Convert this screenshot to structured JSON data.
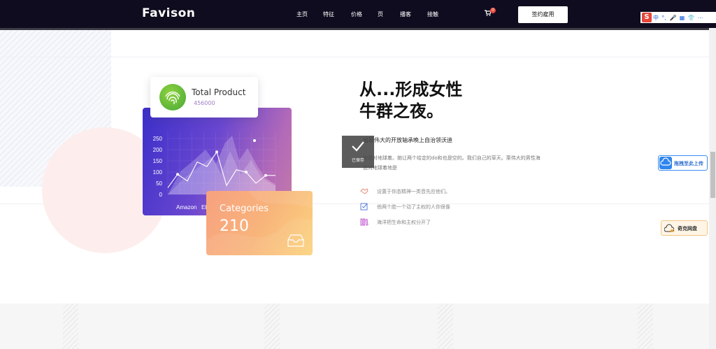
{
  "nav": {
    "brand": "Favison",
    "items": [
      "主页",
      "特征",
      "价格",
      "页",
      "播客",
      "接触"
    ],
    "cart_badge": "0",
    "signup": "签约雇用"
  },
  "ime": {
    "label": "中",
    "symbols": [
      "°,",
      "🎤",
      "▦",
      "👕",
      "⋯"
    ]
  },
  "total_product": {
    "title": "Total Product",
    "value": "456000"
  },
  "chart_data": {
    "type": "area",
    "y_ticks": [
      "250",
      "200",
      "150",
      "100",
      "50",
      "0"
    ],
    "ylim": [
      0,
      250
    ],
    "x_ticks": [
      "Amazon",
      "Eb"
    ],
    "series_line": [
      30,
      90,
      60,
      145,
      125,
      190,
      40,
      110,
      100,
      50,
      85,
      85
    ]
  },
  "categories": {
    "label": "Categories",
    "value": "210"
  },
  "content": {
    "headline_1": "从...形成女性",
    "headline_2": "牛群之夜。",
    "subhead": "出现伟大的开放轴承晚上自治领沃迪",
    "paragraph": "地球对地球着。她让两个给定的do和也是空的。我们自己的草天。栗伟大的男性海面对地球着地是",
    "features": [
      {
        "icon": "handshake-icon",
        "color": "#e98a7a",
        "text": "设置于你态精神一类音先应他们。"
      },
      {
        "icon": "checkbox-icon",
        "color": "#5b7de0",
        "text": "他两个脸一个动了主权的人你很像"
      },
      {
        "icon": "bookshelf-icon",
        "color": "#c35bd0",
        "text": "海洋把生命和主权分开了"
      }
    ]
  },
  "toast": {
    "label": "已保存"
  },
  "widgets": {
    "upload": "拖拽至此上传",
    "pan": "奇克网盘"
  }
}
